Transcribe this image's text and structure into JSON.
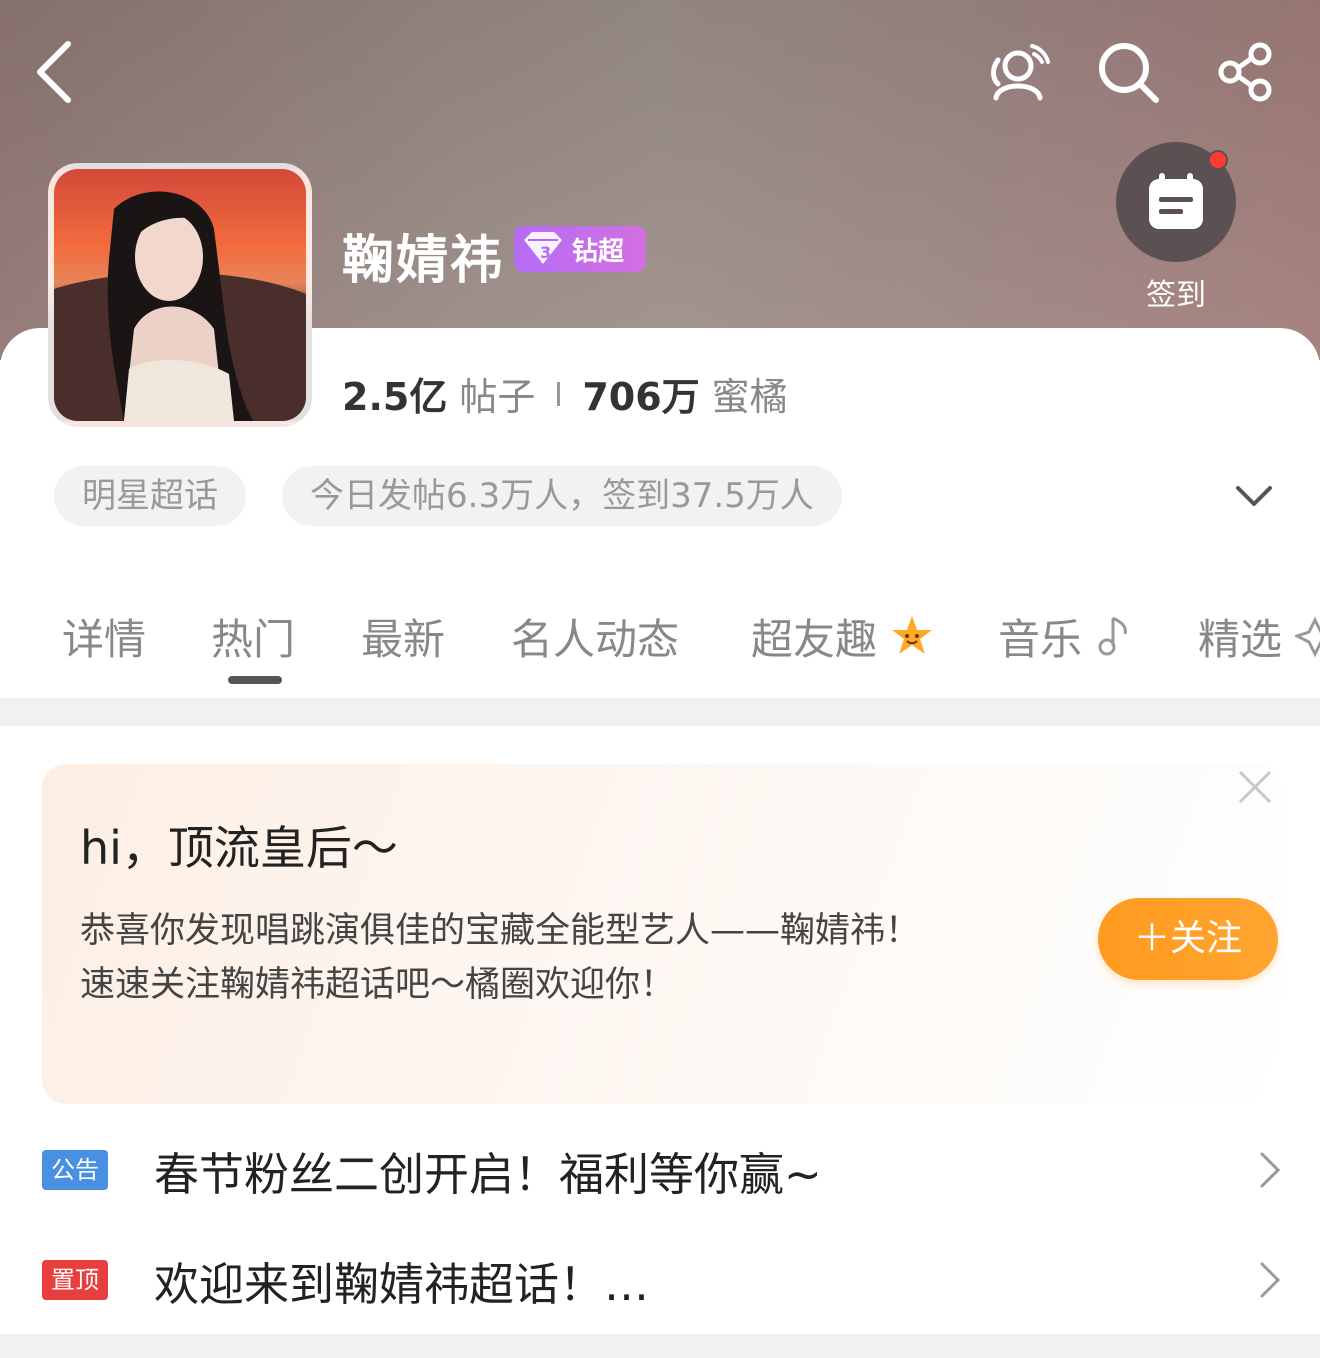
{
  "header": {
    "back_icon": "chevron-left-icon",
    "actions": [
      "group-chat-icon",
      "search-icon",
      "share-icon"
    ]
  },
  "checkin": {
    "label": "签到",
    "icon": "calendar-icon",
    "has_dot": true
  },
  "profile": {
    "name": "鞠婧祎",
    "badge": "钻超",
    "stats": {
      "posts_value": "2.5亿",
      "posts_label": "帖子",
      "fans_value": "706万",
      "fans_label": "蜜橘"
    },
    "tags": {
      "category": "明星超话",
      "today": "今日发帖6.3万人，签到37.5万人"
    }
  },
  "tabs": [
    {
      "label": "详情"
    },
    {
      "label": "热门"
    },
    {
      "label": "最新"
    },
    {
      "label": "名人动态"
    },
    {
      "label": "超友趣"
    },
    {
      "label": "音乐"
    },
    {
      "label": "精选"
    }
  ],
  "welcome": {
    "greeting": "hi，顶流皇后～",
    "line1": "恭喜你发现唱跳演俱佳的宝藏全能型艺人——鞠婧祎！",
    "line2": "速速关注鞠婧祎超话吧～橘圈欢迎你！",
    "follow_label": "＋关注"
  },
  "notices": [
    {
      "tag": "公告",
      "text": "春节粉丝二创开启！福利等你赢~",
      "color": "#4a90e2"
    },
    {
      "tag": "置顶",
      "text": "欢迎来到鞠婧祎超话！…",
      "color": "#e83e3e"
    }
  ],
  "colors": {
    "accent_orange": "#ff9a1f",
    "badge_purple": "#b46df6"
  }
}
